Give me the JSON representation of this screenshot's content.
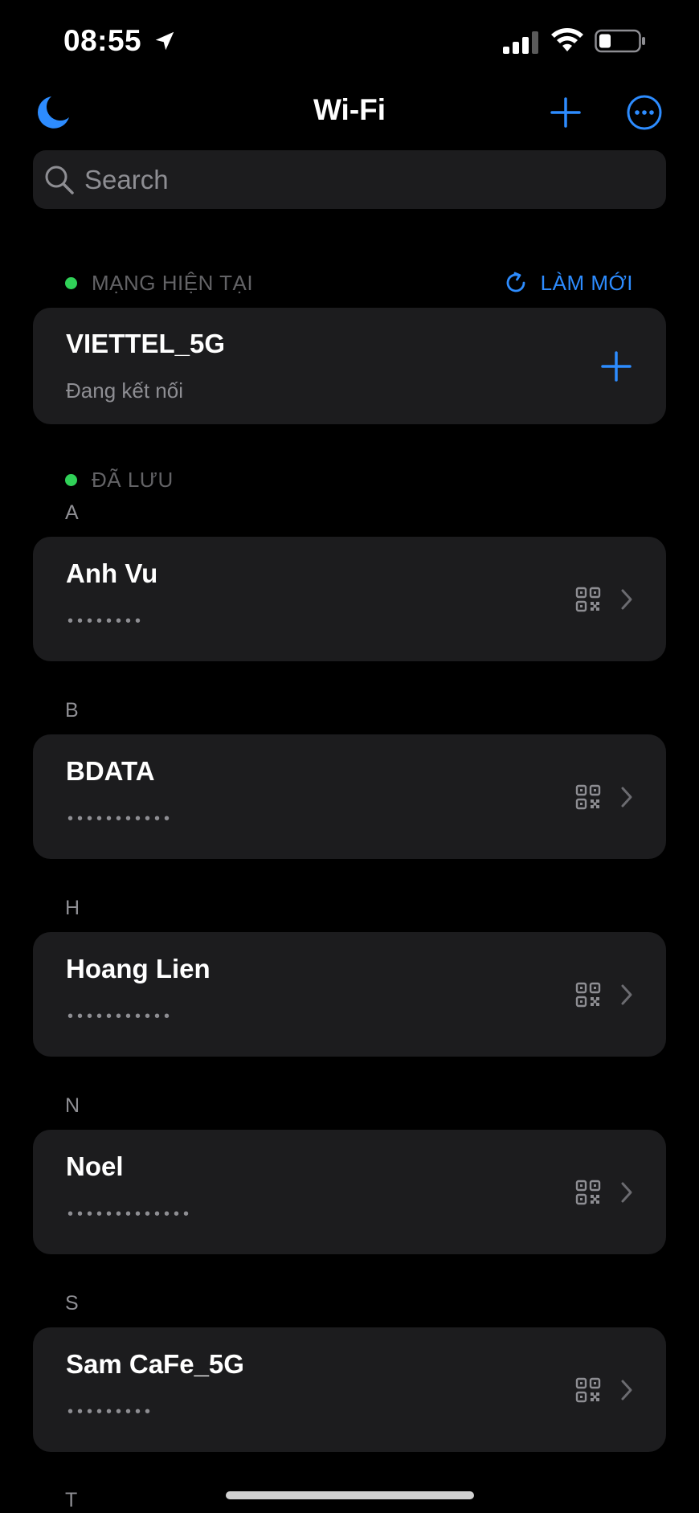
{
  "status_bar": {
    "time": "08:55",
    "icons": [
      "location-arrow-icon",
      "cellular-signal-icon",
      "wifi-icon",
      "battery-icon"
    ]
  },
  "nav": {
    "title": "Wi-Fi",
    "left_icon": "moon-icon",
    "right_icons": [
      "plus-icon",
      "more-icon"
    ]
  },
  "search": {
    "placeholder": "Search"
  },
  "current_network": {
    "header": "MẠNG HIỆN TẠI",
    "refresh_label": "LÀM MỚI",
    "name": "VIETTEL_5G",
    "status": "Đang kết nối"
  },
  "saved": {
    "header": "ĐÃ LƯU",
    "groups": [
      {
        "letter": "A",
        "name": "Anh Vu",
        "password_mask": "••••••••"
      },
      {
        "letter": "B",
        "name": "BDATA",
        "password_mask": "•••••••••••"
      },
      {
        "letter": "H",
        "name": "Hoang Lien",
        "password_mask": "•••••••••••"
      },
      {
        "letter": "N",
        "name": "Noel",
        "password_mask": "•••••••••••••"
      },
      {
        "letter": "S",
        "name": "Sam CaFe_5G",
        "password_mask": "•••••••••"
      }
    ],
    "trailing_letter": "T"
  },
  "colors": {
    "accent": "#2d8cff",
    "status_green": "#30d158",
    "card_bg": "#1c1c1e",
    "background": "#000000"
  }
}
